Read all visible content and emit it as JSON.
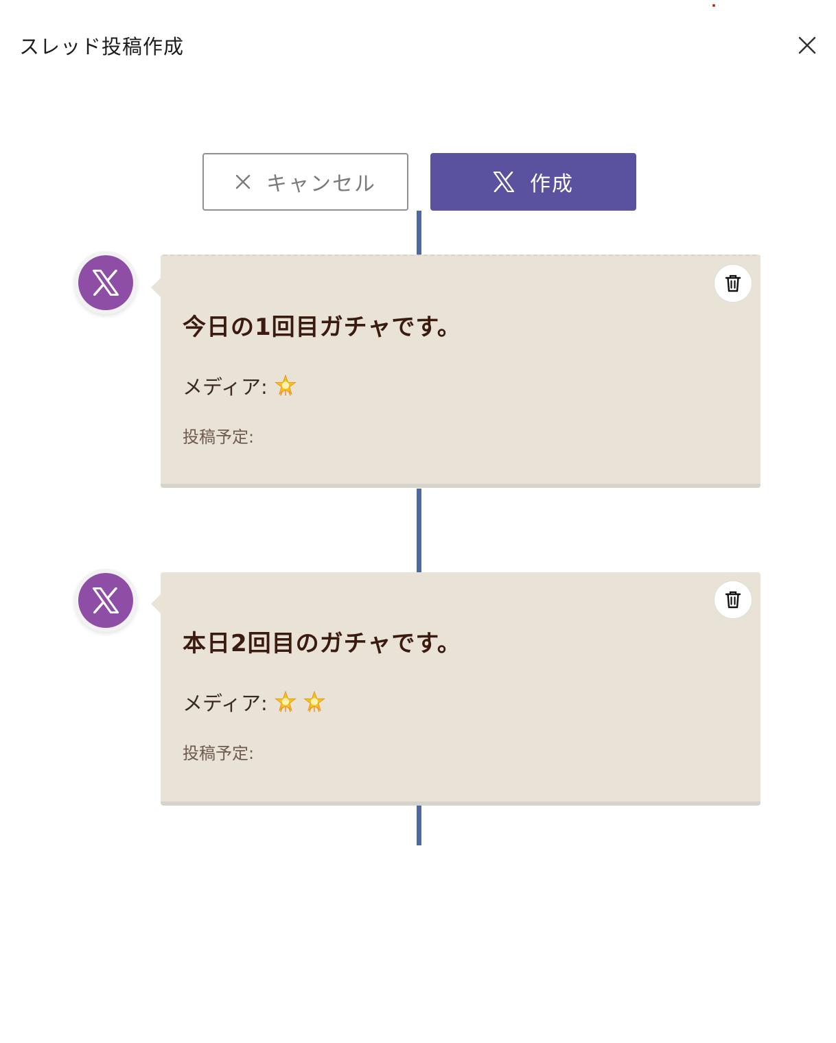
{
  "dialog": {
    "title": "スレッド投稿作成"
  },
  "actions": {
    "cancel_label": "キャンセル",
    "create_label": "作成"
  },
  "posts": [
    {
      "text": "今日の1回目ガチャです。",
      "media_label": "メディア:",
      "media_icons": [
        "star-emoji"
      ],
      "schedule_label": "投稿予定:"
    },
    {
      "text": "本日2回目のガチャです。",
      "media_label": "メディア:",
      "media_icons": [
        "star-emoji",
        "star-emoji"
      ],
      "schedule_label": "投稿予定:"
    }
  ],
  "colors": {
    "create_button": "#5a529f",
    "timeline": "#4f69a2",
    "avatar": "#8e4ea6",
    "card_background": "#e8e3d6"
  }
}
